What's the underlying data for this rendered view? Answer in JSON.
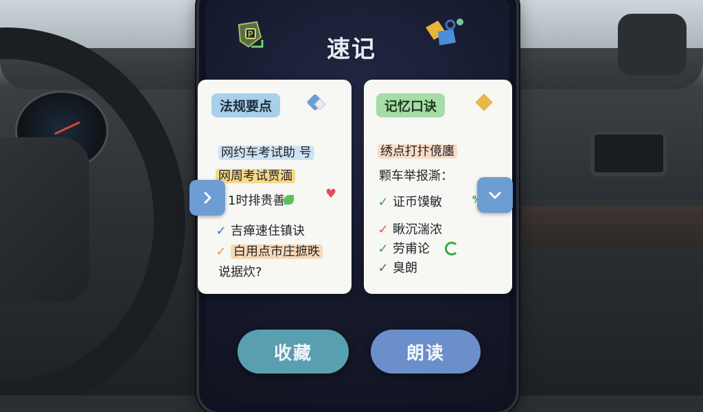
{
  "app": {
    "title": "速记"
  },
  "colors": {
    "accent_blue": "#6d9ed3",
    "collect_button": "#5a9fb0",
    "read_button": "#6a8fca",
    "card_bg": "#f7f7f3",
    "screen_bg": "#161a2d"
  },
  "icons": {
    "top_left": "parking-shield-icon",
    "top_right": "shapes-cube-icon",
    "nav_left": "chevron-right-icon",
    "nav_right": "chevron-down-icon"
  },
  "left_card": {
    "tag": "法规要点",
    "lines": [
      "网约车考试助 号",
      "网周考试贾湎",
      "1时排贵善：",
      "吉瘅速住镇诀",
      "白用点市庄摭昳",
      "说据炊?"
    ],
    "marks": [
      "✓",
      "✓"
    ]
  },
  "right_card": {
    "tag": "记忆口诀",
    "lines": [
      "绣点打抃傹廛",
      "颗车举报澌：",
      "证币馍敏",
      "瞅沉湍浓",
      "劳甫论",
      "臭朗"
    ],
    "marks": [
      "✓",
      "✓",
      "✓",
      "✓"
    ]
  },
  "buttons": {
    "collect": "收藏",
    "read": "朗读"
  }
}
